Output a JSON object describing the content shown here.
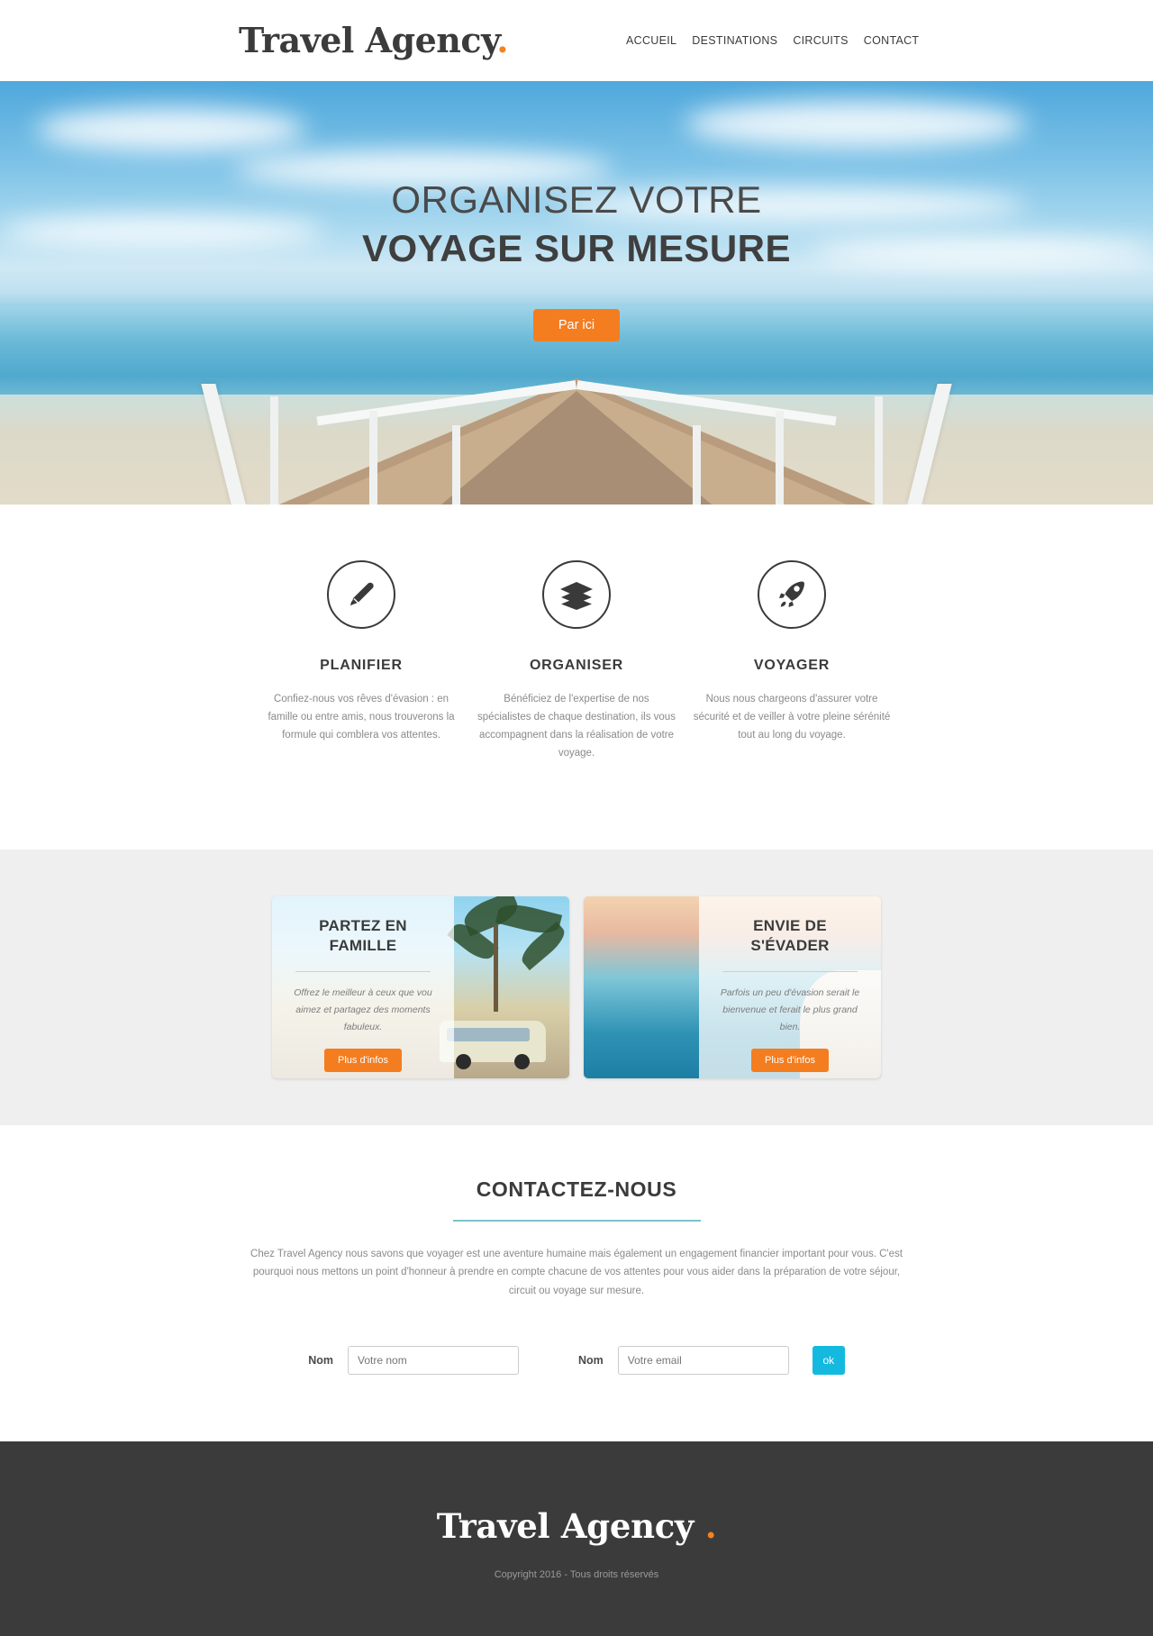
{
  "header": {
    "brand": "Travel Agency",
    "brand_dot": ".",
    "nav": [
      {
        "label": "ACCUEIL"
      },
      {
        "label": "DESTINATIONS"
      },
      {
        "label": "CIRCUITS"
      },
      {
        "label": "CONTACT"
      }
    ]
  },
  "hero": {
    "line1": "ORGANISEZ VOTRE",
    "line2": "VOYAGE SUR MESURE",
    "cta": "Par ici"
  },
  "features": [
    {
      "icon": "pencil-icon",
      "title": "PLANIFIER",
      "text": "Confiez-nous vos rêves d'évasion : en famille ou entre amis, nous trouverons la formule qui comblera vos attentes."
    },
    {
      "icon": "layers-icon",
      "title": "ORGANISER",
      "text": "Bénéficiez de l'expertise de nos spécialistes de chaque destination, ils vous accompagnent dans la réalisation de votre voyage."
    },
    {
      "icon": "rocket-icon",
      "title": "VOYAGER",
      "text": "Nous nous chargeons d'assurer votre sécurité et de veiller à votre pleine sérénité tout au long du voyage."
    }
  ],
  "cards": [
    {
      "title": "PARTEZ EN FAMILLE",
      "text": "Offrez le meilleur à ceux que vou aimez et partagez des moments fabuleux.",
      "button": "Plus d'infos"
    },
    {
      "title": "ENVIE DE S'ÉVADER",
      "text": "Parfois un peu d'évasion serait le bienvenue et ferait le plus grand bien.",
      "button": "Plus d'infos"
    }
  ],
  "contact": {
    "title": "CONTACTEZ-NOUS",
    "text": "Chez Travel Agency nous savons que voyager est une aventure humaine mais également un engagement financier important pour vous. C'est pourquoi nous mettons un point d'honneur à prendre en compte chacune de vos attentes pour vous aider dans la préparation de votre séjour, circuit ou voyage sur mesure.",
    "name_label": "Nom",
    "name_placeholder": "Votre nom",
    "email_label": "Nom",
    "email_placeholder": "Votre email",
    "submit": "ok"
  },
  "footer": {
    "brand": "Travel Agency",
    "brand_dot": ".",
    "copyright": "Copyright 2016 - Tous droits réservés"
  },
  "colors": {
    "orange": "#f47d20",
    "cyan": "#14b9e0",
    "teal_rule": "#7bc2cc",
    "dark": "#3b3b3b"
  }
}
